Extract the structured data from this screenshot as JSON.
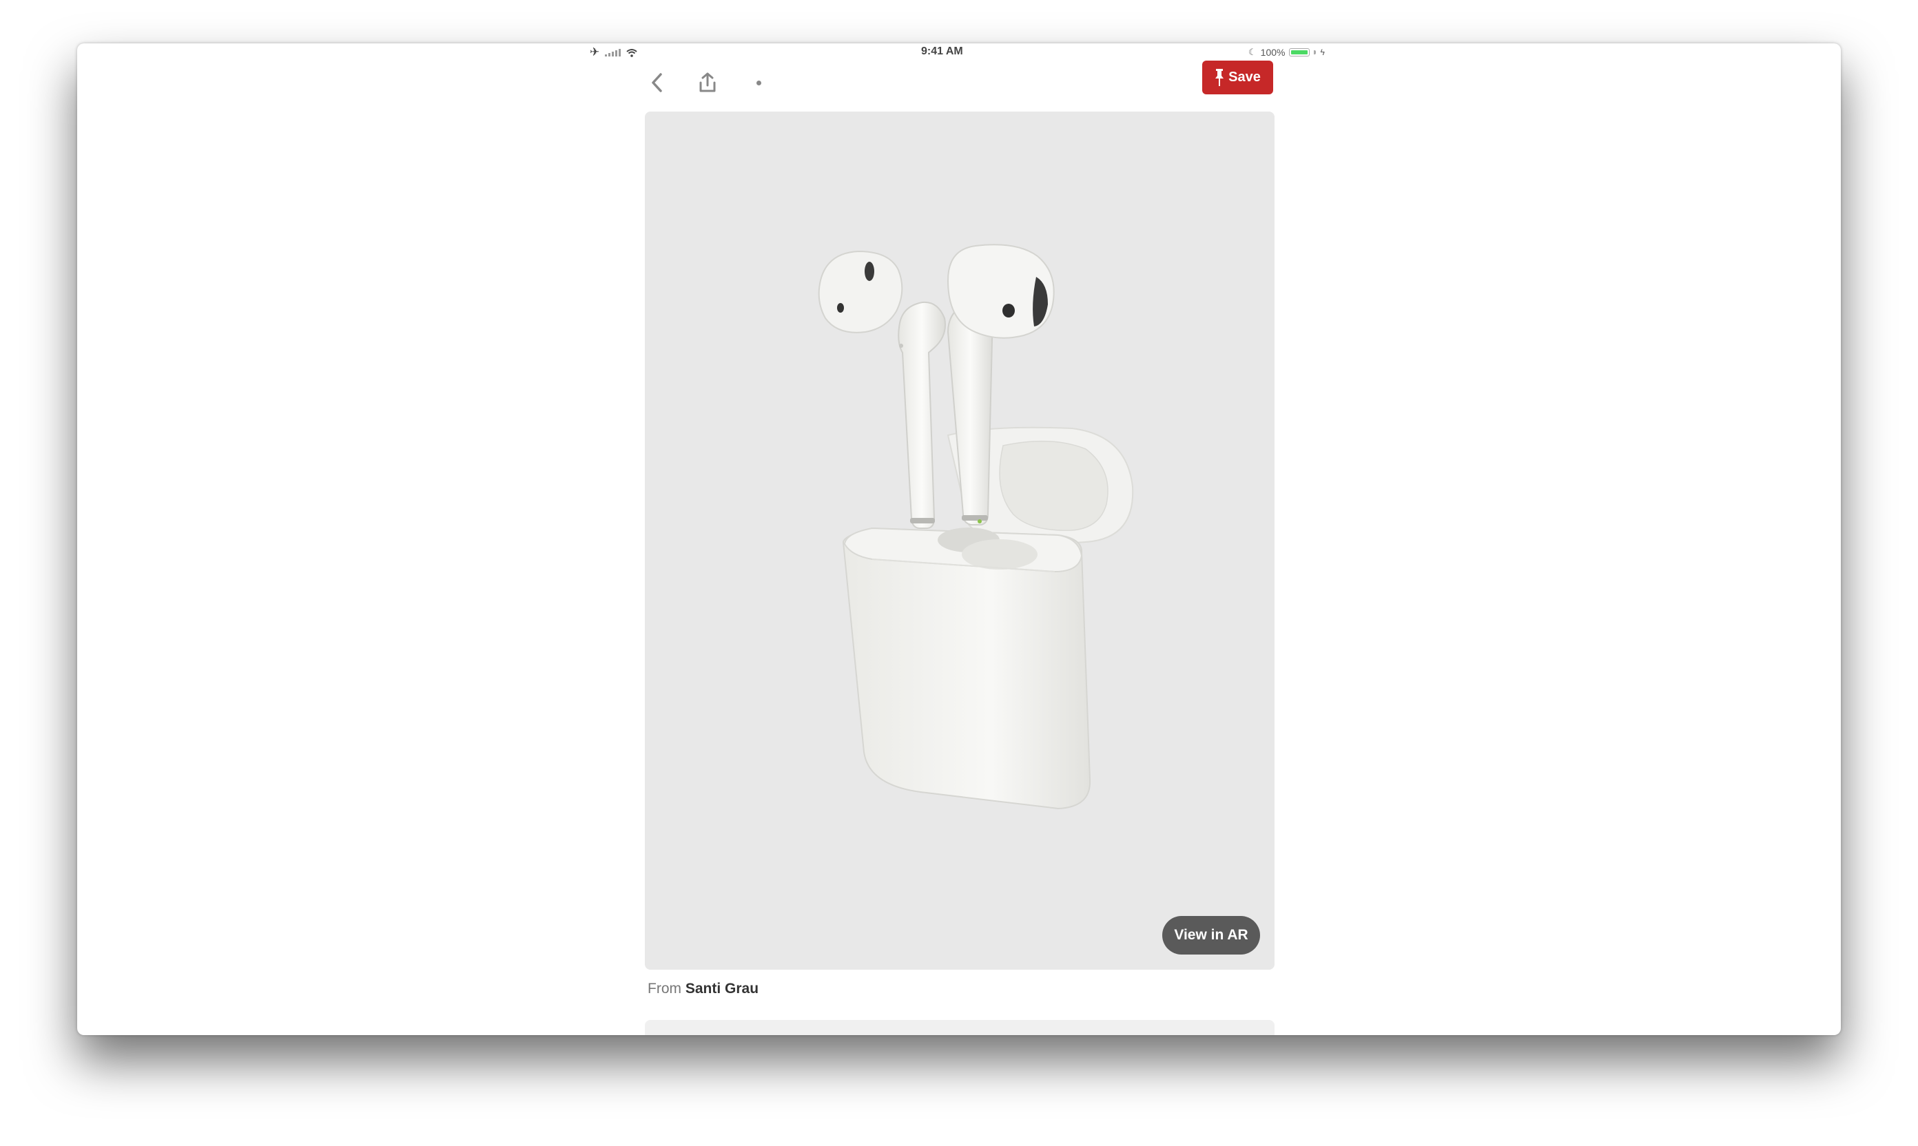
{
  "status_bar": {
    "time": "9:41 AM",
    "battery_percent": "100%",
    "battery_level": 1.0,
    "icons": [
      "airplane-icon",
      "signal-icon",
      "wifi-icon",
      "moon-icon",
      "battery-icon",
      "charging-icon"
    ]
  },
  "toolbar": {
    "back_icon": "chevron-left-icon",
    "share_icon": "share-icon",
    "more_icon": "ellipsis-icon",
    "save_label": "Save",
    "save_icon": "pin-icon"
  },
  "pin": {
    "image_subject": "airpods-3d-model",
    "ar_button_label": "View in AR",
    "source_prefix": "From",
    "source_name": "Santi Grau"
  },
  "colors": {
    "save_button": "#c62828",
    "ar_button": "#5a5a5a",
    "image_background": "#e8e8e8",
    "battery": "#4cd964"
  }
}
